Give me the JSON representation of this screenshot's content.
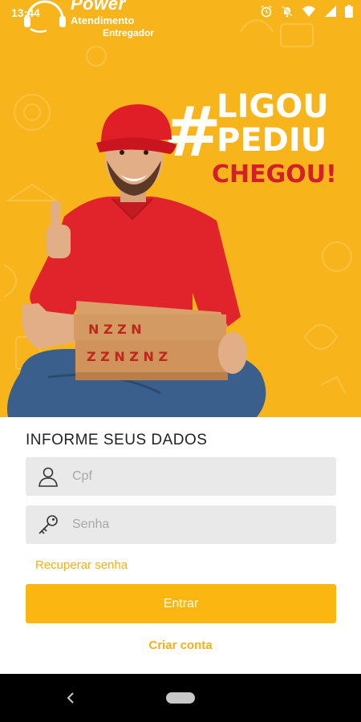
{
  "status_bar": {
    "time": "13:44"
  },
  "brand": {
    "name": "Power",
    "line1": "Atendimento",
    "line2": "Entregador"
  },
  "slogan": {
    "hash": "#",
    "line1": "LIGOU",
    "line2": "PEDIU",
    "line3": "CHEGOU!"
  },
  "pizza_box_text": "pizza",
  "form": {
    "title": "INFORME SEUS DADOS",
    "cpf": {
      "placeholder": "Cpf",
      "value": ""
    },
    "senha": {
      "placeholder": "Senha",
      "value": ""
    },
    "recover_label": "Recuperar senha",
    "enter_label": "Entrar",
    "create_label": "Criar conta"
  },
  "colors": {
    "accent": "#fbb611",
    "hero_bg": "#f7b51b",
    "slogan_red": "#d21f2b",
    "field_bg": "#e9e9e9"
  },
  "icons": {
    "cpf": "user-icon",
    "senha": "key-icon"
  }
}
